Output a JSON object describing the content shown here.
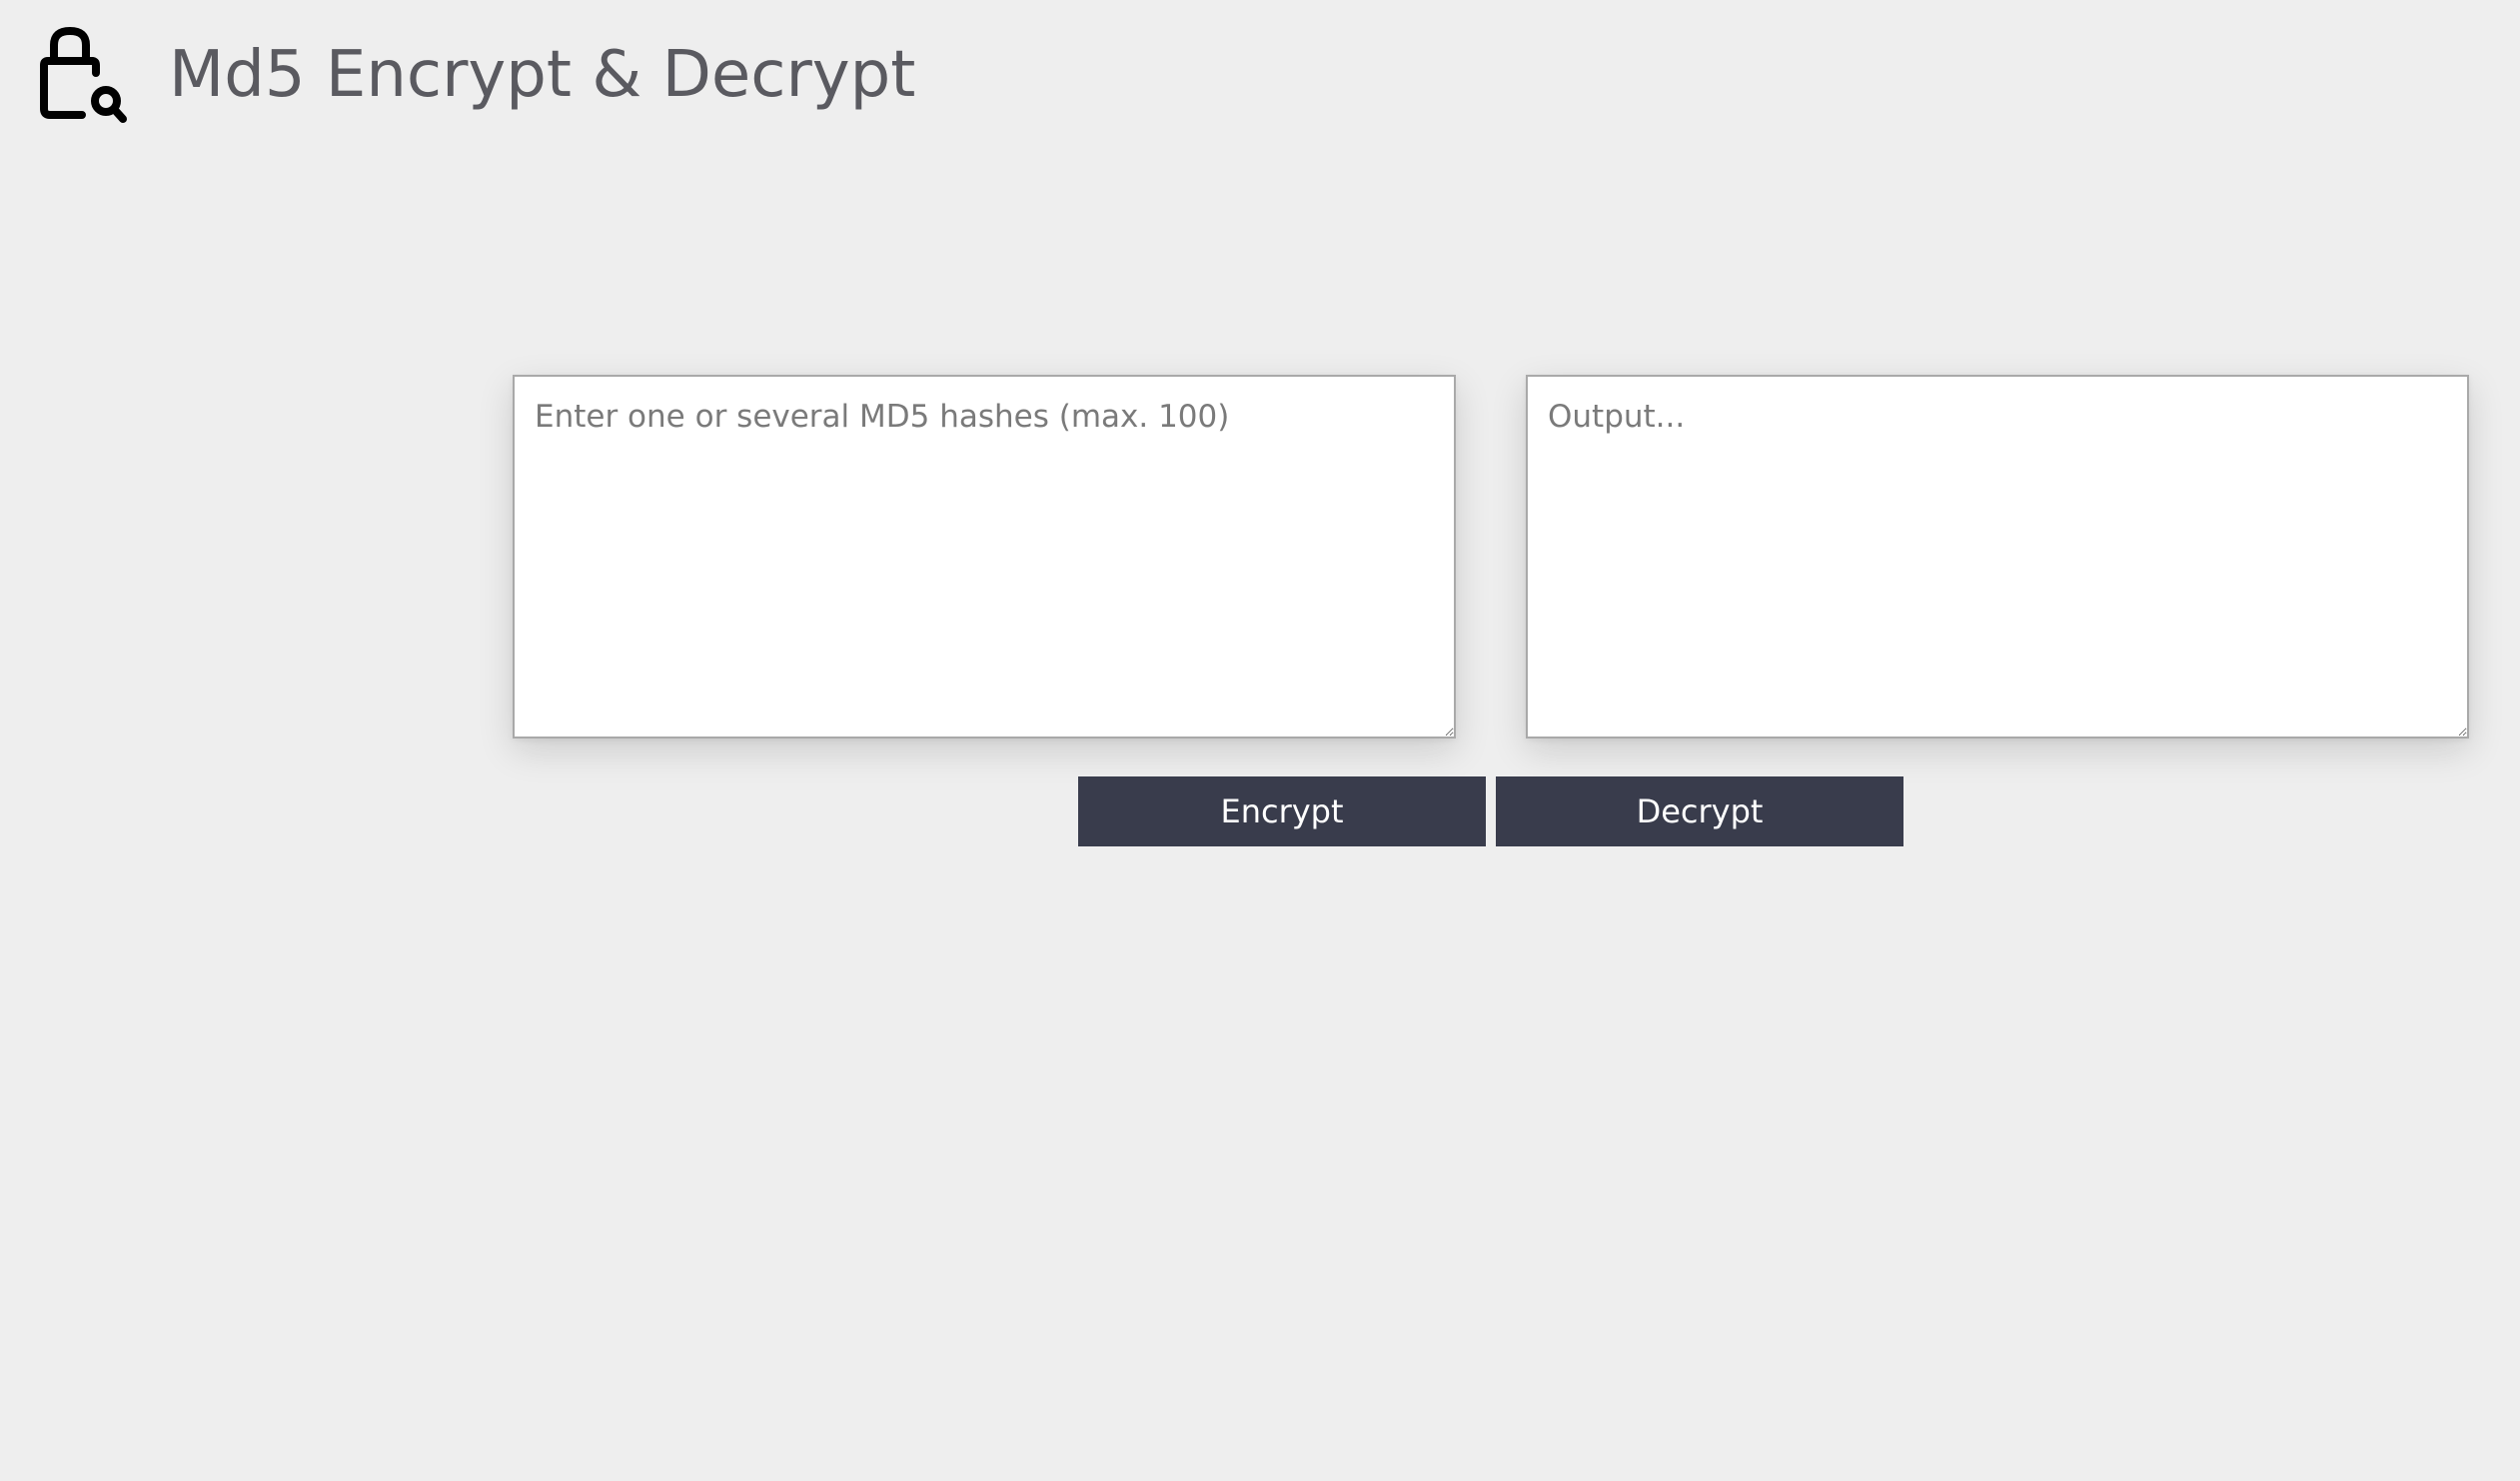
{
  "header": {
    "logo_icon": "lock-search-icon",
    "title": "Md5 Encrypt & Decrypt"
  },
  "input": {
    "value": "",
    "placeholder": "Enter one or several MD5 hashes (max. 100)"
  },
  "output": {
    "value": "",
    "placeholder": "Output..."
  },
  "actions": {
    "encrypt_label": "Encrypt",
    "decrypt_label": "Decrypt"
  },
  "colors": {
    "background": "#eeeeee",
    "title": "#5a5a60",
    "button_bg": "#393c4c",
    "button_text": "#ffffff"
  }
}
